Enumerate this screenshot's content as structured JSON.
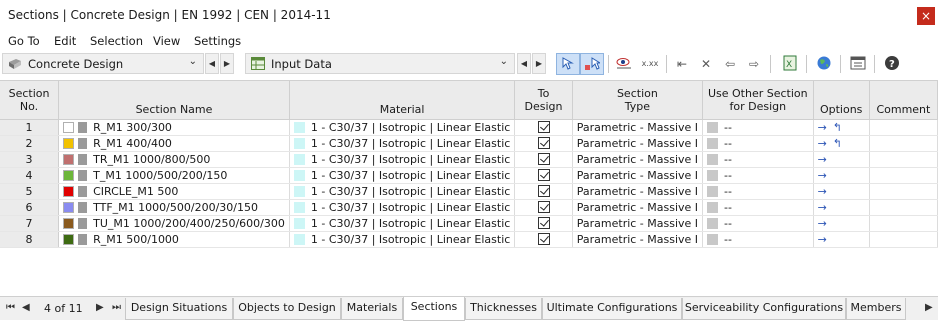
{
  "window": {
    "title": "Sections | Concrete Design | EN 1992 | CEN | 2014-11",
    "close_label": "×"
  },
  "menu": [
    "Go To",
    "Edit",
    "Selection",
    "View",
    "Settings"
  ],
  "toolbar": {
    "module_combo": "Concrete Design",
    "table_combo": "Input Data"
  },
  "table": {
    "headers": {
      "no": [
        "Section",
        "No."
      ],
      "name": "Section Name",
      "material": "Material",
      "to_design": [
        "To",
        "Design"
      ],
      "type": [
        "Section",
        "Type"
      ],
      "use_other": [
        "Use Other Section",
        "for Design"
      ],
      "options": "Options",
      "comment": "Comment"
    },
    "rows": [
      {
        "no": "1",
        "color": "#ffffff",
        "name": "R_M1 300/300",
        "material": "1 - C30/37 | Isotropic | Linear Elastic",
        "type": "Parametric - Massive I",
        "use_other": "--",
        "opt_extra": true
      },
      {
        "no": "2",
        "color": "#f2c200",
        "name": "R_M1 400/400",
        "material": "1 - C30/37 | Isotropic | Linear Elastic",
        "type": "Parametric - Massive I",
        "use_other": "--",
        "opt_extra": true
      },
      {
        "no": "3",
        "color": "#c0706f",
        "name": "TR_M1 1000/800/500",
        "material": "1 - C30/37 | Isotropic | Linear Elastic",
        "type": "Parametric - Massive I",
        "use_other": "--",
        "opt_extra": false
      },
      {
        "no": "4",
        "color": "#6db63a",
        "name": "T_M1 1000/500/200/150",
        "material": "1 - C30/37 | Isotropic | Linear Elastic",
        "type": "Parametric - Massive I",
        "use_other": "--",
        "opt_extra": false
      },
      {
        "no": "5",
        "color": "#e00000",
        "name": "CIRCLE_M1 500",
        "material": "1 - C30/37 | Isotropic | Linear Elastic",
        "type": "Parametric - Massive I",
        "use_other": "--",
        "opt_extra": false
      },
      {
        "no": "6",
        "color": "#8a8cf0",
        "name": "TTF_M1 1000/500/200/30/150",
        "material": "1 - C30/37 | Isotropic | Linear Elastic",
        "type": "Parametric - Massive I",
        "use_other": "--",
        "opt_extra": false
      },
      {
        "no": "7",
        "color": "#8a5a1e",
        "name": "TU_M1 1000/200/400/250/600/300",
        "material": "1 - C30/37 | Isotropic | Linear Elastic",
        "type": "Parametric - Massive I",
        "use_other": "--",
        "opt_extra": false
      },
      {
        "no": "8",
        "color": "#3e6b12",
        "name": "R_M1 500/1000",
        "material": "1 - C30/37 | Isotropic | Linear Elastic",
        "type": "Parametric - Massive I",
        "use_other": "--",
        "opt_extra": false
      }
    ]
  },
  "footer": {
    "page_info": "4 of 11",
    "tabs": [
      "Design Situations",
      "Objects to Design",
      "Materials",
      "Sections",
      "Thicknesses",
      "Ultimate Configurations",
      "Serviceability Configurations",
      "Members"
    ],
    "active_tab": "Sections"
  }
}
